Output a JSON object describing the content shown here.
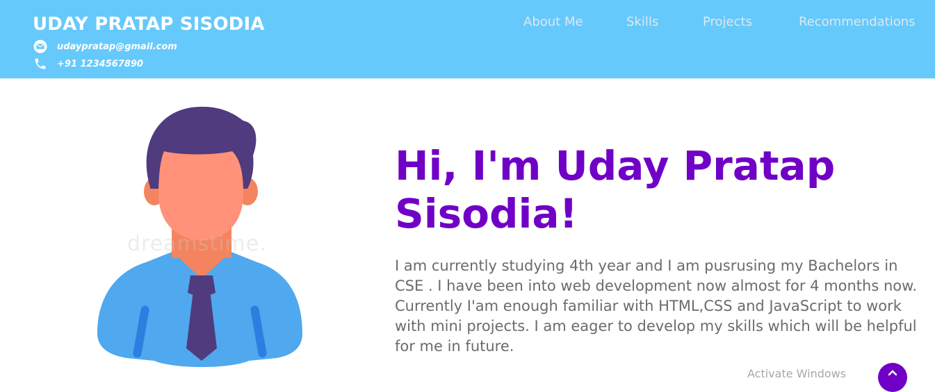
{
  "header": {
    "name": "UDAY PRATAP SISODIA",
    "email": "udaypratap@gmail.com",
    "phone": "+91 1234567890",
    "email_icon": "envelope-icon",
    "phone_icon": "phone-icon",
    "background_color": "#66c9fb"
  },
  "nav": {
    "items": [
      {
        "label": "About Me"
      },
      {
        "label": "Skills"
      },
      {
        "label": "Projects"
      },
      {
        "label": "Recommendations"
      }
    ]
  },
  "hero": {
    "greeting": "Hi, I'm Uday Pratap Sisodia!",
    "bio": "I am currently studying 4th year and I am pusrusing my Bachelors in CSE . I have been into web development now almost for 4 months now. Currently I'am enough familiar with HTML,CSS and JavaScript to work with mini projects. I am eager to develop my skills which will be helpful for me in future.",
    "avatar_icon": "man-avatar-illustration",
    "watermark": "dreamstime.",
    "accent_color": "#7000c6"
  },
  "overlay": {
    "activate_text": "Activate Windows",
    "scroll_top_icon": "arrow-up-icon"
  }
}
